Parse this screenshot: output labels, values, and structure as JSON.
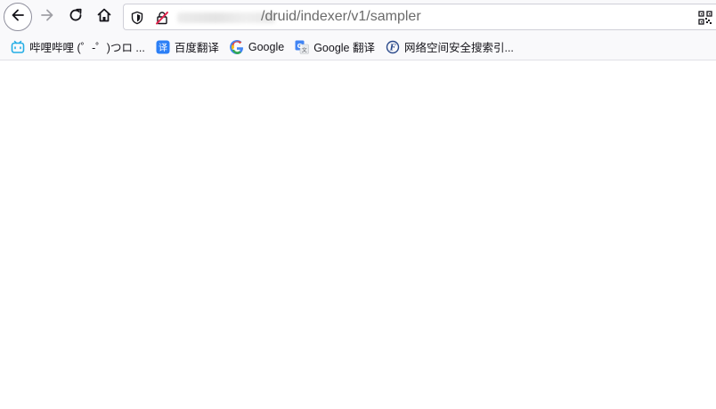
{
  "navigation": {
    "back_icon": "arrow-left-icon",
    "forward_icon": "arrow-right-icon",
    "reload_icon": "reload-icon",
    "home_icon": "home-icon"
  },
  "urlbar": {
    "url_text": "/druid/indexer/v1/sampler",
    "tracking_icon": "shield-icon",
    "insecure_icon": "insecure-lock-icon",
    "qr_icon": "qr-code-icon"
  },
  "bookmarks": [
    {
      "label": "哔哩哔哩 (゜-゜)つロ ...",
      "icon": "bilibili-icon",
      "color": "#23ade5"
    },
    {
      "label": "百度翻译",
      "icon": "baidu-translate-icon",
      "color": "#2c7ff6"
    },
    {
      "label": "Google",
      "icon": "google-icon",
      "color": "#4285f4"
    },
    {
      "label": "Google 翻译",
      "icon": "google-translate-icon",
      "color": "#4285f4"
    },
    {
      "label": "网络空间安全搜索引...",
      "icon": "fofa-icon",
      "color": "#2b4a8b"
    }
  ]
}
